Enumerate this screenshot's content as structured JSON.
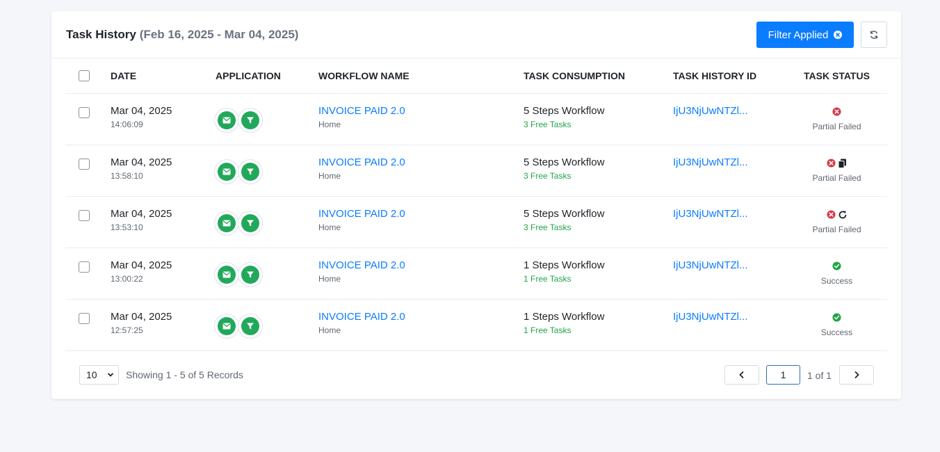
{
  "header": {
    "title": "Task History",
    "range": "(Feb 16, 2025 - Mar 04, 2025)",
    "filter_label": "Filter Applied"
  },
  "columns": {
    "date": "DATE",
    "application": "APPLICATION",
    "workflow": "WORKFLOW NAME",
    "consumption": "TASK CONSUMPTION",
    "history_id": "TASK HISTORY ID",
    "status": "TASK STATUS"
  },
  "rows": [
    {
      "date": "Mar 04, 2025",
      "time": "14:06:09",
      "workflow": "INVOICE PAID 2.0",
      "folder": "Home",
      "steps": "5 Steps Workflow",
      "free": "3 Free Tasks",
      "id": "IjU3NjUwNTZl...",
      "status": "Partial Failed",
      "extra_icon": ""
    },
    {
      "date": "Mar 04, 2025",
      "time": "13:58:10",
      "workflow": "INVOICE PAID 2.0",
      "folder": "Home",
      "steps": "5 Steps Workflow",
      "free": "3 Free Tasks",
      "id": "IjU3NjUwNTZl...",
      "status": "Partial Failed",
      "extra_icon": "copy-icon"
    },
    {
      "date": "Mar 04, 2025",
      "time": "13:53:10",
      "workflow": "INVOICE PAID 2.0",
      "folder": "Home",
      "steps": "5 Steps Workflow",
      "free": "3 Free Tasks",
      "id": "IjU3NjUwNTZl...",
      "status": "Partial Failed",
      "extra_icon": "retry-icon"
    },
    {
      "date": "Mar 04, 2025",
      "time": "13:00:22",
      "workflow": "INVOICE PAID 2.0",
      "folder": "Home",
      "steps": "1 Steps Workflow",
      "free": "1 Free Tasks",
      "id": "IjU3NjUwNTZl...",
      "status": "Success",
      "extra_icon": ""
    },
    {
      "date": "Mar 04, 2025",
      "time": "12:57:25",
      "workflow": "INVOICE PAID 2.0",
      "folder": "Home",
      "steps": "1 Steps Workflow",
      "free": "1 Free Tasks",
      "id": "IjU3NjUwNTZl...",
      "status": "Success",
      "extra_icon": ""
    }
  ],
  "footer": {
    "page_size": "10",
    "showing": "Showing 1 - 5 of 5 Records",
    "page": "1",
    "page_of": "1 of 1"
  },
  "colors": {
    "accent": "#0a7cff",
    "success": "#22a447",
    "failed": "#d63a48",
    "app_icon": "#22a85a"
  }
}
